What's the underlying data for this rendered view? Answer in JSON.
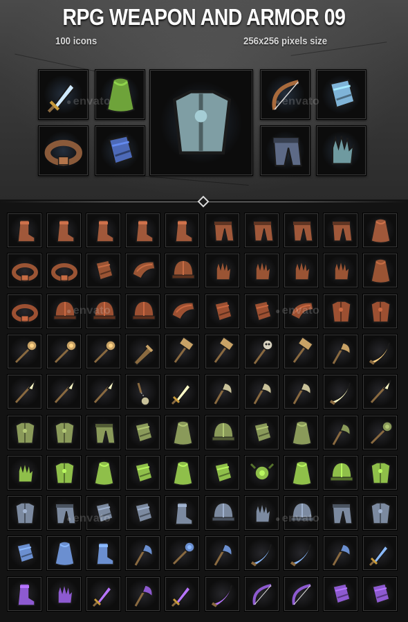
{
  "header": {
    "title": "RPG WEAPON AND ARMOR 09",
    "icon_count": "100 icons",
    "pixel_size": "256x256  pixels size"
  },
  "watermark_text": "envato",
  "featured_icons": [
    {
      "name": "sword-icon",
      "color": "#9fb3c8"
    },
    {
      "name": "green-cape-icon",
      "color": "#6ea33a"
    },
    {
      "name": "shoulder-armor-icon",
      "color": "#7f9ea4"
    },
    {
      "name": "bow-icon",
      "color": "#a86a3c"
    },
    {
      "name": "blue-gauntlet-icon",
      "color": "#7fb4d8"
    },
    {
      "name": "belt-icon",
      "color": "#8a5a3a"
    },
    {
      "name": "blue-bracer-icon",
      "color": "#4d6ab8"
    },
    {
      "name": "leg-armor-icon",
      "color": "#5d6a86"
    },
    {
      "name": "claw-gauntlet-icon",
      "color": "#6f9aa0"
    }
  ],
  "grid_rows": [
    {
      "theme": "brown-boots-and-pants",
      "color": "#a0583a",
      "icons": [
        "boot-icon",
        "boot-icon",
        "boot-icon",
        "boot-icon",
        "boot-icon",
        "pants-icon",
        "pants-icon",
        "pants-icon",
        "pants-icon",
        "cape-icon"
      ]
    },
    {
      "theme": "brown-belts-and-gloves",
      "color": "#9a5434",
      "icons": [
        "belt-icon",
        "belt-icon",
        "bracer-icon",
        "shoulder-icon",
        "helmet-icon",
        "glove-icon",
        "glove-icon",
        "glove-icon",
        "glove-icon",
        "cape-icon"
      ]
    },
    {
      "theme": "brown-armor",
      "color": "#9c5032",
      "icons": [
        "belt-icon",
        "hat-icon",
        "helmet-icon",
        "helmet-icon",
        "shoulder-icon",
        "bracer-icon",
        "bracer-icon",
        "shoulder-icon",
        "chest-armor-icon",
        "chest-armor-icon"
      ]
    },
    {
      "theme": "maces-and-axes",
      "color": "#c8a266",
      "icons": [
        "mace-icon",
        "mace-icon",
        "mace-icon",
        "club-icon",
        "hammer-icon",
        "hammer-icon",
        "skull-staff-icon",
        "hammer-icon",
        "axe-icon",
        "scimitar-icon"
      ]
    },
    {
      "theme": "spears-and-blades",
      "color": "#c9c29a",
      "icons": [
        "spear-icon",
        "spear-icon",
        "spear-icon",
        "flail-icon",
        "dagger-icon",
        "axe-icon",
        "axe-icon",
        "axe-icon",
        "knife-icon",
        "spear-icon"
      ]
    },
    {
      "theme": "green-armor",
      "color": "#8a9a5a",
      "icons": [
        "chest-armor-icon",
        "chest-armor-icon",
        "pants-icon",
        "bracer-icon",
        "cape-icon",
        "helmet-icon",
        "bracer-icon",
        "hood-icon",
        "axe-icon",
        "mace-icon"
      ]
    },
    {
      "theme": "green-gear",
      "color": "#8fbf4a",
      "icons": [
        "glove-icon",
        "chest-armor-icon",
        "cape-icon",
        "bracer-icon",
        "cape-icon",
        "bracer-icon",
        "amulet-icon",
        "hood-icon",
        "helmet-icon",
        "chest-armor-icon"
      ]
    },
    {
      "theme": "steel-armor",
      "color": "#7c8aa0",
      "icons": [
        "chest-armor-icon",
        "pants-icon",
        "gauntlet-icon",
        "gauntlet-icon",
        "boot-icon",
        "helmet-icon",
        "glove-icon",
        "helmet-icon",
        "pants-icon",
        "chest-armor-icon"
      ]
    },
    {
      "theme": "blue-armor-and-weapons",
      "color": "#6b8fd0",
      "icons": [
        "bracer-icon",
        "cape-icon",
        "greave-icon",
        "axe-icon",
        "mace-icon",
        "axe-icon",
        "knife-icon",
        "knife-icon",
        "axe-icon",
        "sword-icon"
      ]
    },
    {
      "theme": "purple-gear",
      "color": "#8d5ad0",
      "icons": [
        "boot-icon",
        "glove-icon",
        "sword-icon",
        "axe-icon",
        "sword-icon",
        "knife-icon",
        "bow-icon",
        "bow-icon",
        "gauntlet-icon",
        "bracer-icon"
      ]
    }
  ]
}
